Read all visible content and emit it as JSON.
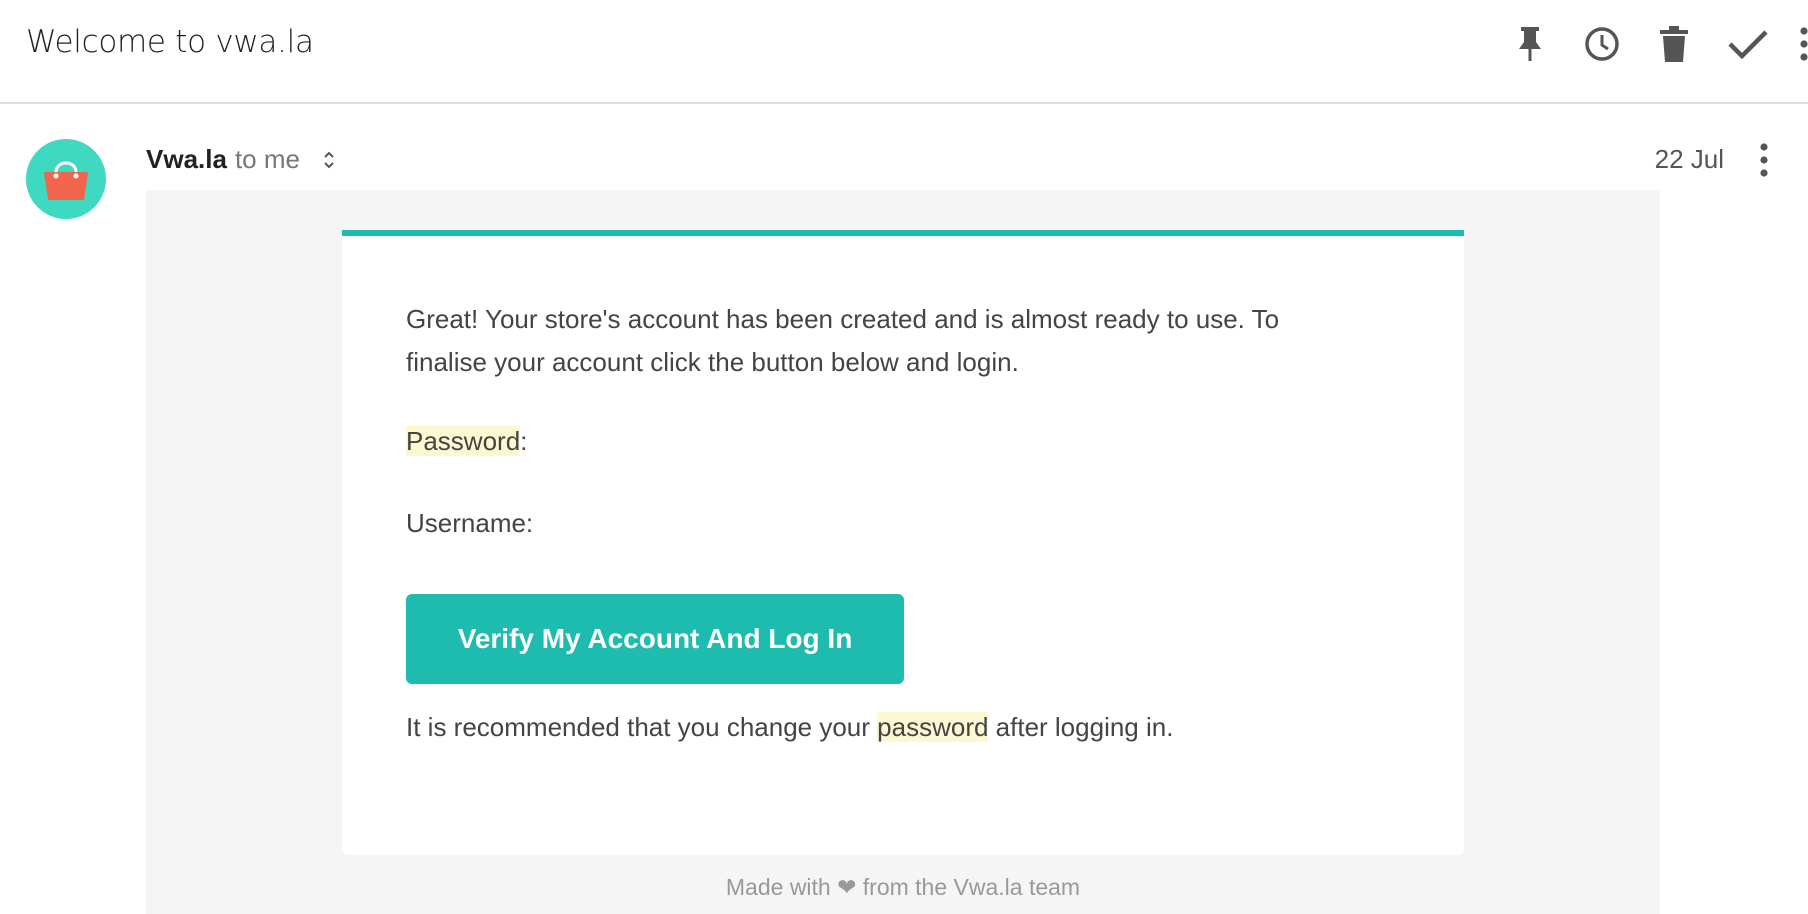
{
  "header": {
    "subject": "Welcome to vwa.la",
    "actions": [
      {
        "name": "pin-icon",
        "label": "Pin"
      },
      {
        "name": "clock-icon",
        "label": "Snooze"
      },
      {
        "name": "trash-icon",
        "label": "Delete"
      },
      {
        "name": "check-icon",
        "label": "Done"
      },
      {
        "name": "more-vert-icon",
        "label": "More"
      }
    ]
  },
  "message": {
    "sender_name": "Vwa.la",
    "recipient_text": "to me",
    "date": "22 Jul",
    "avatar_icon": "handbag-icon"
  },
  "email_body": {
    "intro": "Great! Your store's account has been created and is almost ready to use. To finalise your account click the button below and login.",
    "password_label": "Password",
    "password_colon": ":",
    "username_label": "Username:",
    "button_label": "Verify My Account And Log In",
    "recommend_before": "It is recommended that you change your ",
    "recommend_highlight": "password",
    "recommend_after": " after logging in.",
    "footer_before": "Made with ",
    "footer_heart": "❤",
    "footer_after": " from the Vwa.la team"
  },
  "colors": {
    "accent": "#1dbcae",
    "avatar_bg": "#3fd8c0",
    "bag": "#f0654b",
    "highlight": "#fbf8d2",
    "email_background": "#f5f5f5"
  }
}
